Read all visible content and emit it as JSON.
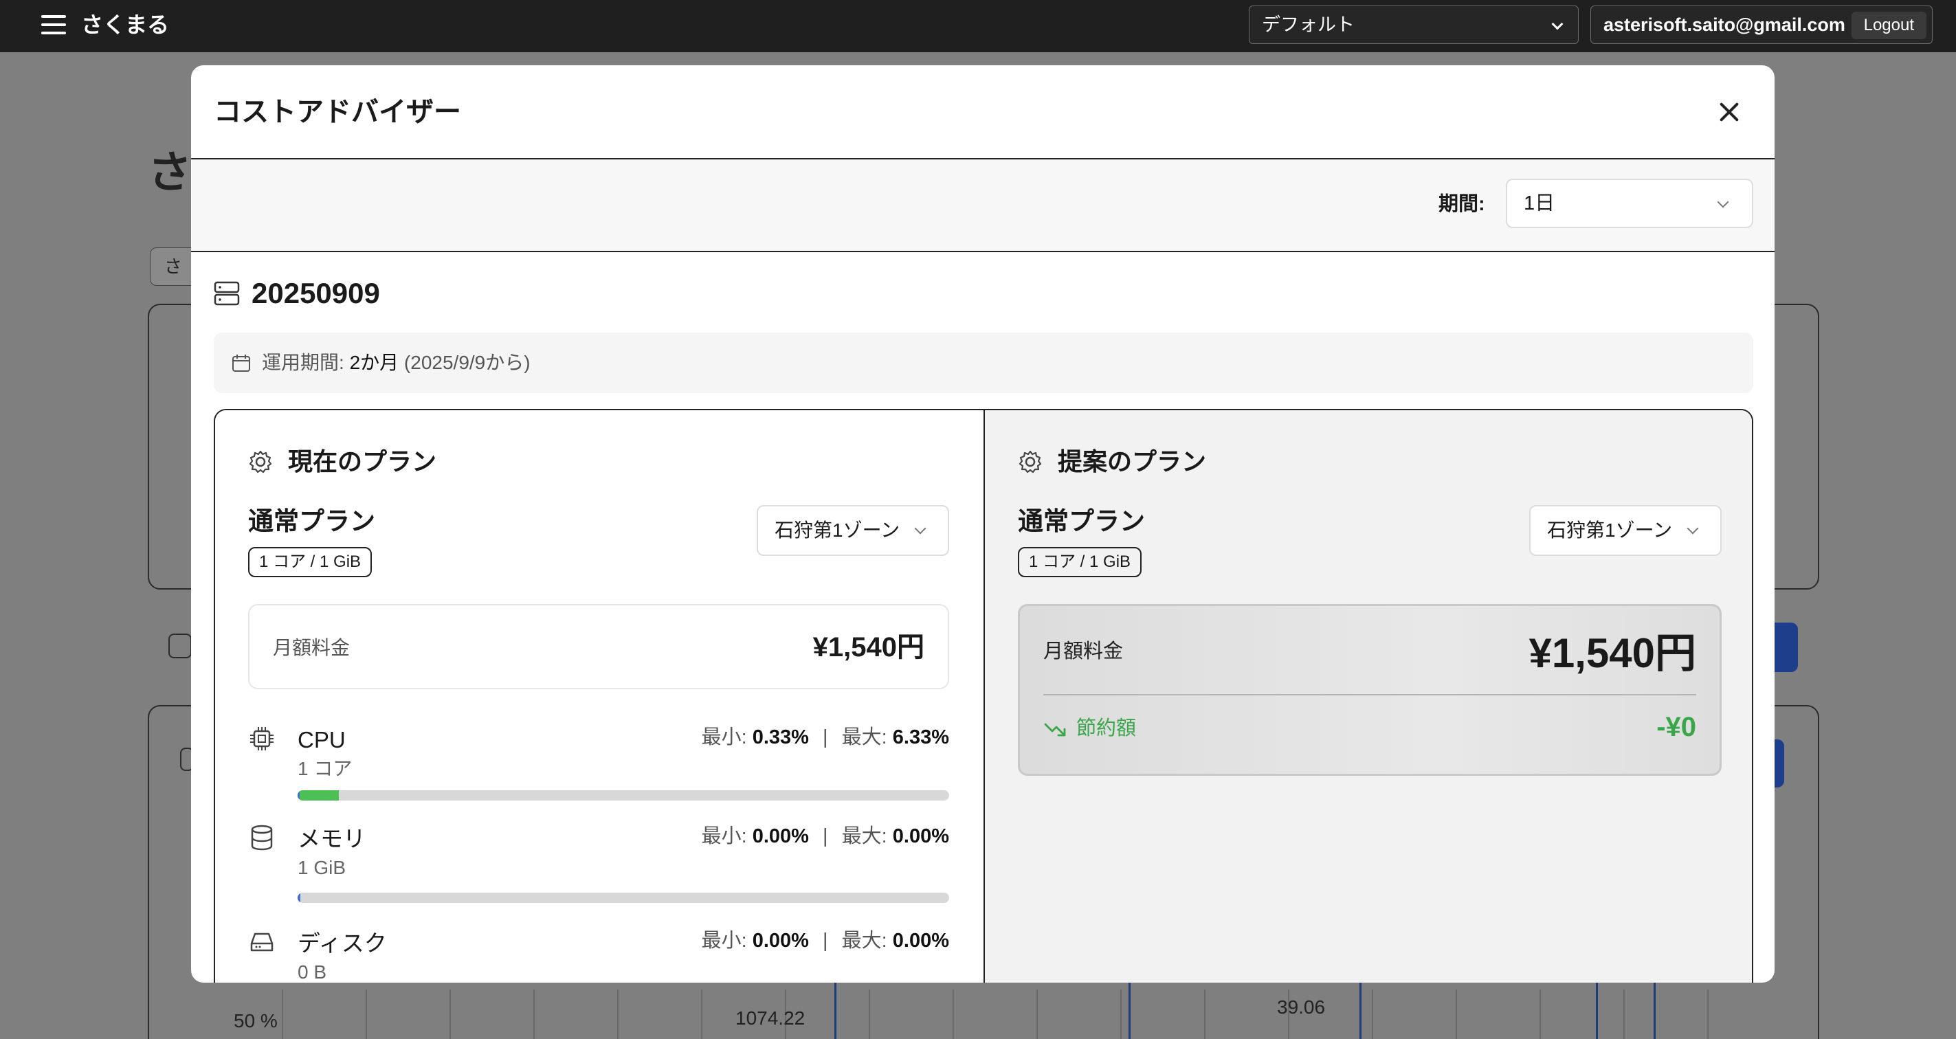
{
  "navbar": {
    "brand": "さくまる",
    "project_select": "デフォルト",
    "user_email": "asterisoft.saito@gmail.com",
    "logout_label": "Logout"
  },
  "background": {
    "title_fragment": "さ",
    "chip_fragment": "さ",
    "tick_50": "50 %",
    "tick_1074": "1074.22",
    "tick_39": "39.06"
  },
  "modal": {
    "title": "コストアドバイザー",
    "period_label": "期間:",
    "period_value": "1日",
    "server_name": "20250909",
    "ops_label": "運用期間:",
    "ops_value": "2か月",
    "ops_since": "(2025/9/9から)"
  },
  "current_plan": {
    "heading": "現在のプラン",
    "plan_name": "通常プラン",
    "spec": "1 コア / 1 GiB",
    "zone": "石狩第1ゾーン",
    "price_label": "月額料金",
    "price_value": "¥1,540円",
    "stats_min_label": "最小:",
    "stats_max_label": "最大:",
    "stats_sep": "|",
    "metrics": [
      {
        "name": "CPU",
        "sub": "1 コア",
        "min": "0.33%",
        "max": "6.33%",
        "min_frac": 0.0033,
        "max_frac": 0.0633,
        "icon": "cpu-icon"
      },
      {
        "name": "メモリ",
        "sub": "1 GiB",
        "min": "0.00%",
        "max": "0.00%",
        "min_frac": 0.004,
        "max_frac": 0.0,
        "icon": "database-icon"
      },
      {
        "name": "ディスク",
        "sub": "0 B",
        "min": "0.00%",
        "max": "0.00%",
        "min_frac": 0.0,
        "max_frac": 0.0,
        "icon": "disk-icon"
      }
    ]
  },
  "proposed_plan": {
    "heading": "提案のプラン",
    "plan_name": "通常プラン",
    "spec": "1 コア / 1 GiB",
    "zone": "石狩第1ゾーン",
    "price_label": "月額料金",
    "price_value": "¥1,540円",
    "savings_label": "節約額",
    "savings_value": "-¥0"
  },
  "colors": {
    "accent_green": "#3aa64a",
    "bar_blue": "#3b6fe0",
    "bar_green": "#4cbf55",
    "navbar": "#1f1f1f"
  }
}
